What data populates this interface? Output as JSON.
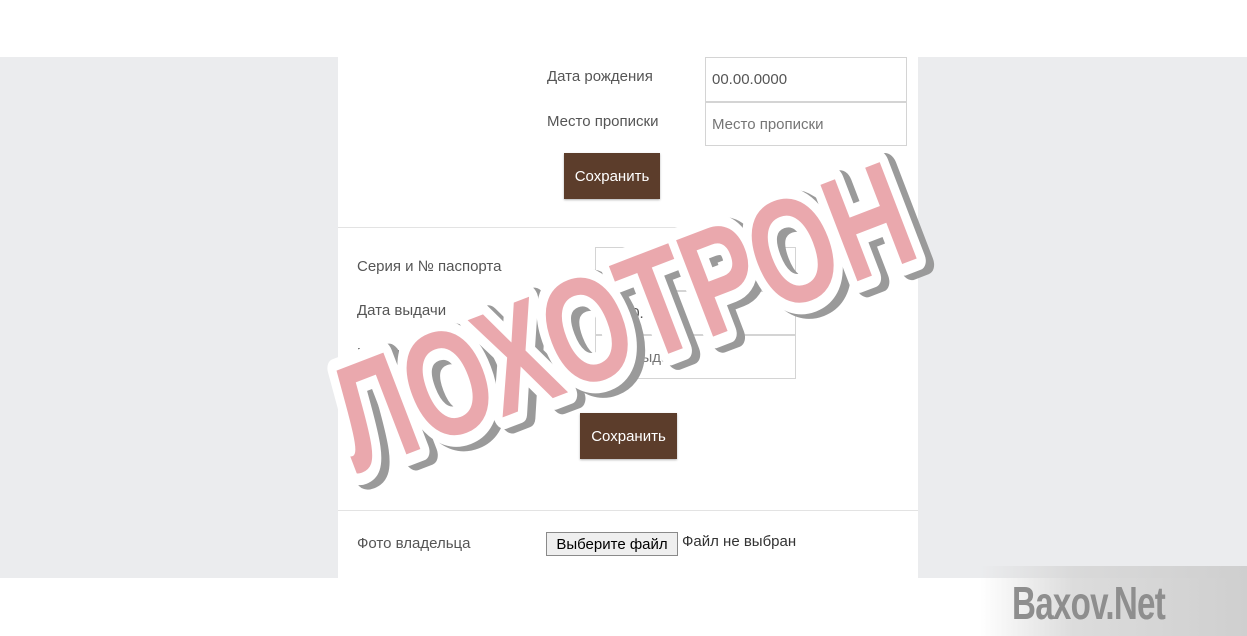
{
  "form": {
    "birth_date": {
      "label": "Дата рождения",
      "value": "00.00.0000"
    },
    "registration": {
      "label": "Место прописки",
      "placeholder": "Место прописки"
    },
    "save_label_1": "Сохранить",
    "passport_number": {
      "label": "Серия и № паспорта",
      "value": "0000000000"
    },
    "issue_date": {
      "label": "Дата выдачи",
      "value": "00.00.0000"
    },
    "issued_by": {
      "label": "Кем выдан",
      "placeholder": "Кем выдан"
    },
    "save_label_2": "Сохранить",
    "owner_photo": {
      "label": "Фото владельца",
      "button": "Выберите файл",
      "status": "Файл не выбран"
    }
  },
  "stamp": {
    "text": "ЛОХОТРОН",
    "color": "#e8a1a6"
  },
  "watermark": {
    "text": "Baxov.Net"
  },
  "colors": {
    "button_bg": "#5c3d2b",
    "page_bg": "#ebecee"
  }
}
